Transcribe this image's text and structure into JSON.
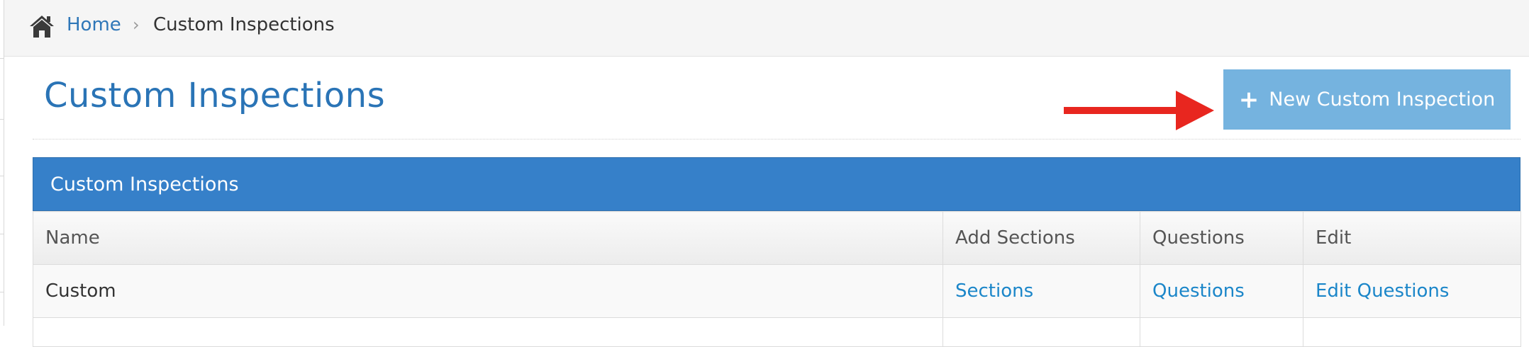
{
  "breadcrumb": {
    "home_icon": "home-icon",
    "home_label": "Home",
    "separator": "›",
    "current_label": "Custom Inspections"
  },
  "page": {
    "title": "Custom Inspections"
  },
  "actions": {
    "new_button_icon": "plus-icon",
    "new_button_label": "New Custom Inspection"
  },
  "panel": {
    "title": "Custom Inspections"
  },
  "table": {
    "columns": [
      "Name",
      "Add Sections",
      "Questions",
      "Edit"
    ],
    "rows": [
      {
        "name": "Custom",
        "sections_link": "Sections",
        "questions_link": "Questions",
        "edit_link": "Edit Questions"
      }
    ]
  },
  "colors": {
    "title_blue": "#2a74b6",
    "link_blue": "#1b86c9",
    "panel_blue": "#3680c9",
    "button_light_blue": "#75b3df",
    "annotation_arrow_red": "#e8261f"
  }
}
